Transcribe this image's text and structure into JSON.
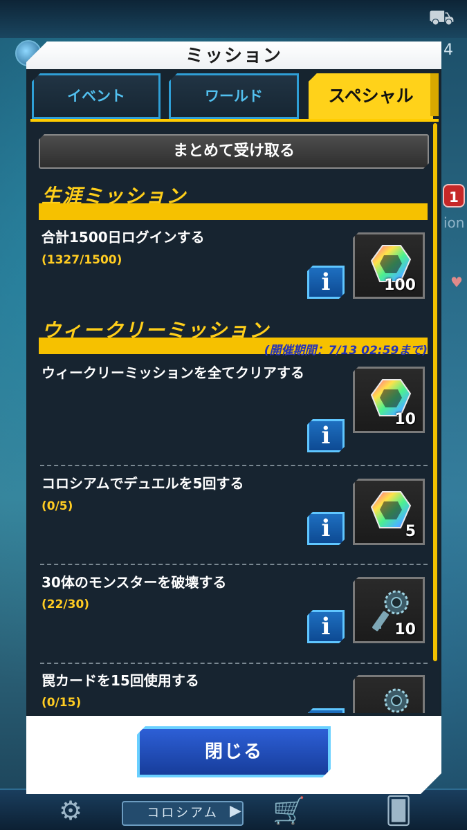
{
  "modal": {
    "title": "ミッション",
    "tabs": [
      {
        "label": "イベント",
        "active": false
      },
      {
        "label": "ワールド",
        "active": false
      },
      {
        "label": "スペシャル",
        "active": true
      }
    ],
    "collect_all_label": "まとめて受け取る",
    "close_label": "閉じる"
  },
  "sections": [
    {
      "title": "生涯ミッション",
      "missions": [
        {
          "name": "合計1500日ログインする",
          "progress": "(1327/1500)",
          "reward": {
            "icon": "gem-icon",
            "qty": "100"
          }
        }
      ]
    },
    {
      "title": "ウィークリーミッション",
      "period": "(開催期間：7/13 02:59まで)",
      "missions": [
        {
          "name": "ウィークリーミッションを全てクリアする",
          "progress": "",
          "reward": {
            "icon": "gem-icon",
            "qty": "10"
          }
        },
        {
          "name": "コロシアムでデュエルを5回する",
          "progress": "(0/5)",
          "reward": {
            "icon": "gem-icon",
            "qty": "5"
          }
        },
        {
          "name": "30体のモンスターを破壊する",
          "progress": "(22/30)",
          "reward": {
            "icon": "key-icon",
            "qty": "10"
          }
        },
        {
          "name": "罠カードを15回使用する",
          "progress": "(0/15)",
          "reward": {
            "icon": "key-icon",
            "qty": ""
          }
        }
      ]
    }
  ],
  "info_label": "i",
  "background": {
    "right_number": "4",
    "notification_badge": "1",
    "right_text": "ion",
    "bottom_nav_label": "コロシアム"
  },
  "colors": {
    "accent_yellow": "#ffd21a",
    "tab_blue": "#2f9fd6",
    "panel_dark": "#16242f",
    "progress_yellow": "#ffcc22",
    "period_blue": "#2432b8"
  }
}
